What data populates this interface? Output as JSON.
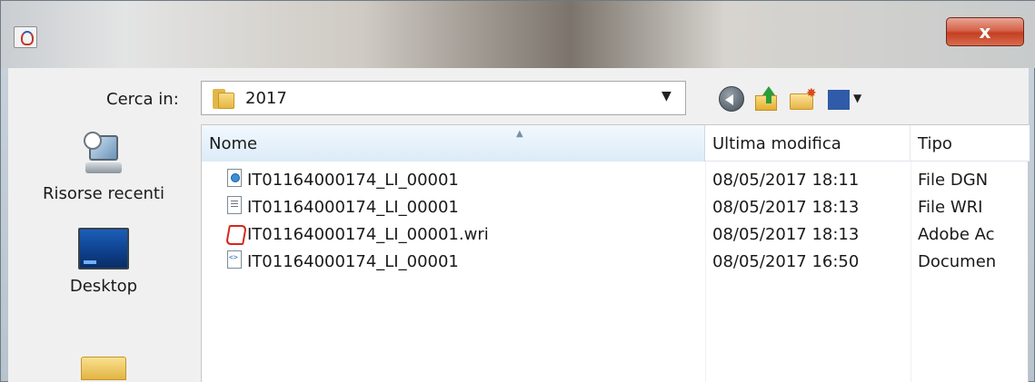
{
  "window": {
    "icon": "java-icon",
    "close_label": "x"
  },
  "toolbar": {
    "lookin_label": "Cerca in:",
    "lookin_value": "2017",
    "back_icon": "back-arrow-icon",
    "up_icon": "up-folder-icon",
    "new_folder_icon": "new-folder-icon",
    "view_menu_icon": "view-menu-icon"
  },
  "places": [
    {
      "label": "Risorse recenti",
      "icon": "recent-items-icon"
    },
    {
      "label": "Desktop",
      "icon": "desktop-icon"
    },
    {
      "label": "",
      "icon": "documents-folder-icon"
    }
  ],
  "table": {
    "columns": [
      "Nome",
      "Ultima modifica",
      "Tipo"
    ],
    "sorted_column": "Nome",
    "rows": [
      {
        "name": "IT01164000174_LI_00001",
        "modified": "08/05/2017 18:11",
        "type": "File DGN",
        "icon": "dgn-file-icon"
      },
      {
        "name": "IT01164000174_LI_00001",
        "modified": "08/05/2017 18:13",
        "type": "File WRI",
        "icon": "wri-file-icon"
      },
      {
        "name": "IT01164000174_LI_00001.wri",
        "modified": "08/05/2017 18:13",
        "type": "Adobe Ac",
        "icon": "pdf-file-icon"
      },
      {
        "name": "IT01164000174_LI_00001",
        "modified": "08/05/2017 16:50",
        "type": "Documen",
        "icon": "xml-file-icon"
      }
    ]
  }
}
